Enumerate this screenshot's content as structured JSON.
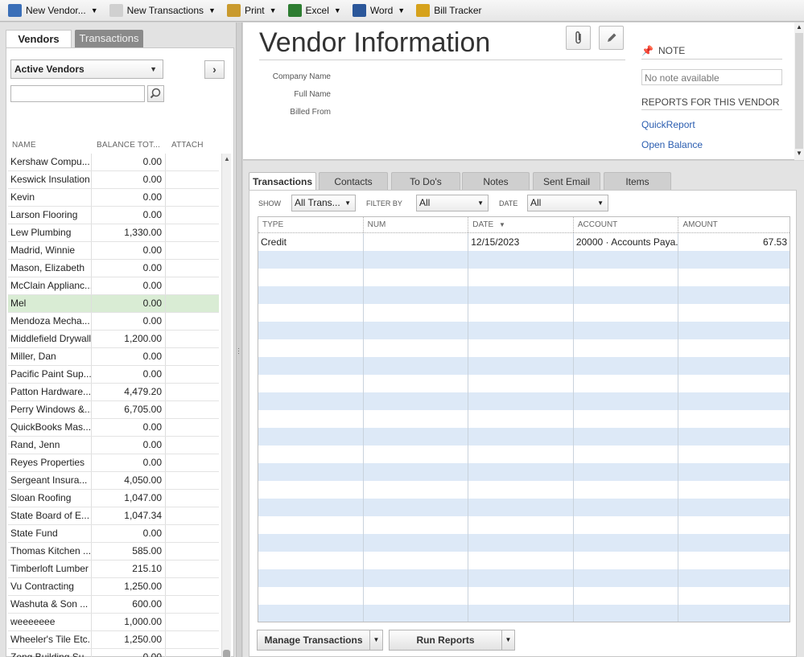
{
  "toolbar": {
    "items": [
      {
        "label": "New Vendor...",
        "icon": "new-vendor-icon",
        "color": "#3b6fb8",
        "has_menu": true
      },
      {
        "label": "New Transactions",
        "icon": "new-transactions-icon",
        "color": "#d0d0d0",
        "has_menu": true
      },
      {
        "label": "Print",
        "icon": "print-icon",
        "color": "#c99a2e",
        "has_menu": true
      },
      {
        "label": "Excel",
        "icon": "excel-icon",
        "color": "#2e7d32",
        "has_menu": true
      },
      {
        "label": "Word",
        "icon": "word-icon",
        "color": "#2b579a",
        "has_menu": true
      },
      {
        "label": "Bill Tracker",
        "icon": "bill-tracker-icon",
        "color": "#d6a21c",
        "has_menu": false
      }
    ]
  },
  "left": {
    "tabs": {
      "vendors": "Vendors",
      "transactions": "Transactions"
    },
    "filter_value": "Active Vendors",
    "search_value": "",
    "columns": {
      "name": "NAME",
      "balance": "BALANCE TOT...",
      "attach": "ATTACH"
    },
    "vendors": [
      {
        "name": "Kershaw Compu...",
        "balance": "0.00"
      },
      {
        "name": "Keswick Insulation",
        "balance": "0.00"
      },
      {
        "name": "Kevin",
        "balance": "0.00"
      },
      {
        "name": "Larson Flooring",
        "balance": "0.00"
      },
      {
        "name": "Lew Plumbing",
        "balance": "1,330.00"
      },
      {
        "name": "Madrid, Winnie",
        "balance": "0.00"
      },
      {
        "name": "Mason, Elizabeth",
        "balance": "0.00"
      },
      {
        "name": "McClain Applianc...",
        "balance": "0.00"
      },
      {
        "name": "Mel",
        "balance": "0.00"
      },
      {
        "name": "Mendoza Mecha...",
        "balance": "0.00"
      },
      {
        "name": "Middlefield Drywall",
        "balance": "1,200.00"
      },
      {
        "name": "Miller, Dan",
        "balance": "0.00"
      },
      {
        "name": "Pacific Paint Sup...",
        "balance": "0.00"
      },
      {
        "name": "Patton Hardware...",
        "balance": "4,479.20"
      },
      {
        "name": "Perry Windows &...",
        "balance": "6,705.00"
      },
      {
        "name": "QuickBooks Mas...",
        "balance": "0.00"
      },
      {
        "name": "Rand, Jenn",
        "balance": "0.00"
      },
      {
        "name": "Reyes Properties",
        "balance": "0.00"
      },
      {
        "name": "Sergeant Insura...",
        "balance": "4,050.00"
      },
      {
        "name": "Sloan Roofing",
        "balance": "1,047.00"
      },
      {
        "name": "State Board of E...",
        "balance": "1,047.34"
      },
      {
        "name": "State Fund",
        "balance": "0.00"
      },
      {
        "name": "Thomas Kitchen ...",
        "balance": "585.00"
      },
      {
        "name": "Timberloft Lumber",
        "balance": "215.10"
      },
      {
        "name": "Vu Contracting",
        "balance": "1,250.00"
      },
      {
        "name": "Washuta & Son ...",
        "balance": "600.00"
      },
      {
        "name": "weeeeeee",
        "balance": "1,000.00"
      },
      {
        "name": "Wheeler's Tile Etc.",
        "balance": "1,250.00"
      },
      {
        "name": "Zeng Building Su...",
        "balance": "0.00"
      },
      {
        "name": "",
        "balance": ""
      }
    ],
    "selected_index": 8,
    "selected_color": "#d9ecd4"
  },
  "info": {
    "title": "Vendor Information",
    "company_name_label": "Company Name",
    "full_name_label": "Full Name",
    "billed_from_label": "Billed From",
    "note_header": "NOTE",
    "note_placeholder": "No note available",
    "reports_header": "REPORTS FOR THIS VENDOR",
    "quickreport_link": "QuickReport",
    "open_balance_link": "Open Balance",
    "link_color": "#2a5db0"
  },
  "tx": {
    "tabs": [
      "Transactions",
      "Contacts",
      "To Do's",
      "Notes",
      "Sent Email",
      "Items"
    ],
    "show_label": "SHOW",
    "show_value": "All Trans...",
    "filter_label": "FILTER BY",
    "filter_value": "All",
    "date_label": "DATE",
    "date_value": "All",
    "columns": {
      "type": "TYPE",
      "num": "NUM",
      "date": "DATE",
      "account": "ACCOUNT",
      "amount": "AMOUNT"
    },
    "rows": [
      {
        "type": "Credit",
        "num": "",
        "date": "12/15/2023",
        "account": "20000 · Accounts Paya...",
        "amount": "67.53"
      }
    ],
    "manage_button": "Manage Transactions",
    "run_reports_button": "Run Reports",
    "row_alt_color": "#dde9f7"
  }
}
